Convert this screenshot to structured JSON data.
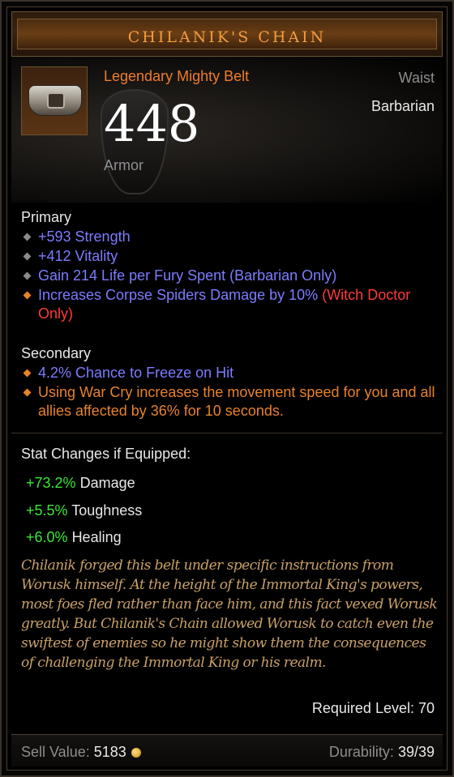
{
  "item": {
    "name": "CHILANIK'S CHAIN",
    "type": "Legendary Mighty Belt",
    "slot": "Waist",
    "class": "Barbarian",
    "armor_value": "448",
    "armor_label": "Armor"
  },
  "primary": {
    "title": "Primary",
    "stats": [
      {
        "text": "+593 Strength"
      },
      {
        "text": "+412 Vitality"
      },
      {
        "text": "Gain 214 Life per Fury Spent (Barbarian Only)"
      },
      {
        "text": "Increases Corpse Spiders Damage by 10%",
        "suffix": "(Witch Doctor Only)"
      }
    ]
  },
  "secondary": {
    "title": "Secondary",
    "stats": [
      {
        "text": "4.2% Chance to Freeze on Hit"
      },
      {
        "text": "Using War Cry increases the movement speed for you and all allies affected by 36% for 10 seconds."
      }
    ]
  },
  "stat_changes": {
    "title": "Stat Changes if Equipped:",
    "items": [
      {
        "value": "+73.2%",
        "label": "Damage"
      },
      {
        "value": "+5.5%",
        "label": "Toughness"
      },
      {
        "value": "+6.0%",
        "label": "Healing"
      }
    ]
  },
  "flavor_text": "Chilanik forged this belt under specific instructions from Worusk himself. At the height of the Immortal King's powers, most foes fled rather than face him, and this fact vexed Worusk greatly. But Chilanik's Chain allowed Worusk to catch even the swiftest of enemies so he might show them the consequences of challenging the Immortal King or his realm.",
  "required_level": "Required Level: 70",
  "footer": {
    "sell_label": "Sell Value:",
    "sell_value": "5183",
    "durability_label": "Durability:",
    "durability_value": "39/39"
  },
  "colors": {
    "legendary": "#f07c2a",
    "magic_stat": "#7c7cff",
    "legendary_affix": "#e8822a",
    "class_restriction": "#ff3a3a",
    "positive_change": "#37e837",
    "flavor": "#c9a067"
  },
  "icons": [
    "belt-icon",
    "shield-icon",
    "gold-coin-icon"
  ]
}
